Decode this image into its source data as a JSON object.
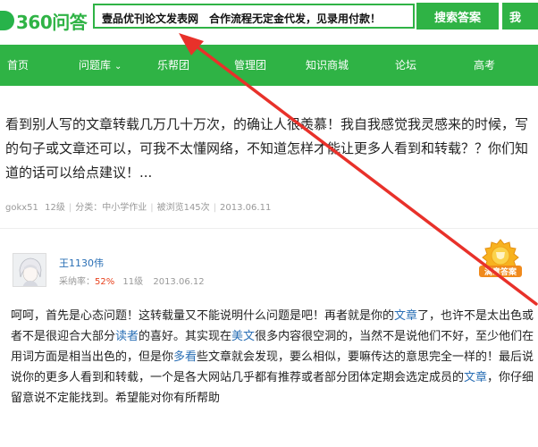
{
  "header": {
    "logo_text": "360问答",
    "search_value": "壹品优刊论文发表网　合作流程无定金代发，见录用付款！",
    "search_button": "搜索答案",
    "ask_button": "我"
  },
  "nav": {
    "items": [
      {
        "label": "首页"
      },
      {
        "label": "问题库",
        "caret": "⌄"
      },
      {
        "label": "乐帮团"
      },
      {
        "label": "管理团"
      },
      {
        "label": "知识商城"
      },
      {
        "label": "论坛"
      },
      {
        "label": "高考"
      }
    ]
  },
  "question": {
    "text": "看到别人写的文章转载几万几十万次，的确让人很羡慕！我自我感觉我灵感来的时候，写的句子或文章还可以，可我不太懂网络，不知道怎样才能让更多人看到和转载？？你们知道的话可以给点建议！...",
    "author": "gokx51",
    "level": "12级",
    "category": "分类：中小学作业",
    "views": "被浏览145次",
    "date": "2013.06.11"
  },
  "answer": {
    "user_name": "王1130伟",
    "rate_label": "采纳率：",
    "rate_value": "52%",
    "level": "11级",
    "date": "2013.06.12",
    "badge_text": "满意答案",
    "segments": [
      {
        "t": "呵呵，首先是心态问题！这转载量又不能说明什么问题是吧！再者就是你的",
        "link": false
      },
      {
        "t": "文章",
        "link": true
      },
      {
        "t": "了，也许不是太出色或者不是很迎合大部分",
        "link": false
      },
      {
        "t": "读者",
        "link": true
      },
      {
        "t": "的喜好。其实现在",
        "link": false
      },
      {
        "t": "美文",
        "link": true
      },
      {
        "t": "很多内容很空洞的，当然不是说他们不好，至少他们在用词方面是相当出色的，但是你",
        "link": false
      },
      {
        "t": "多看",
        "link": true
      },
      {
        "t": "些文章就会发现，要么相似，要嘛传达的意思完全一样的！最后说说你的更多人看到和转载，一个是各大网站几乎都有推荐或者部分团体定期会选定成员的",
        "link": false
      },
      {
        "t": "文章",
        "link": true
      },
      {
        "t": "，你仔细留意说不定能找到。希望能对你有所帮助",
        "link": false
      }
    ]
  },
  "colors": {
    "brand_green": "#2fb345",
    "link_blue": "#2a6fb5",
    "annotation_red": "#e8312a",
    "badge_orange": "#f29a1c"
  }
}
